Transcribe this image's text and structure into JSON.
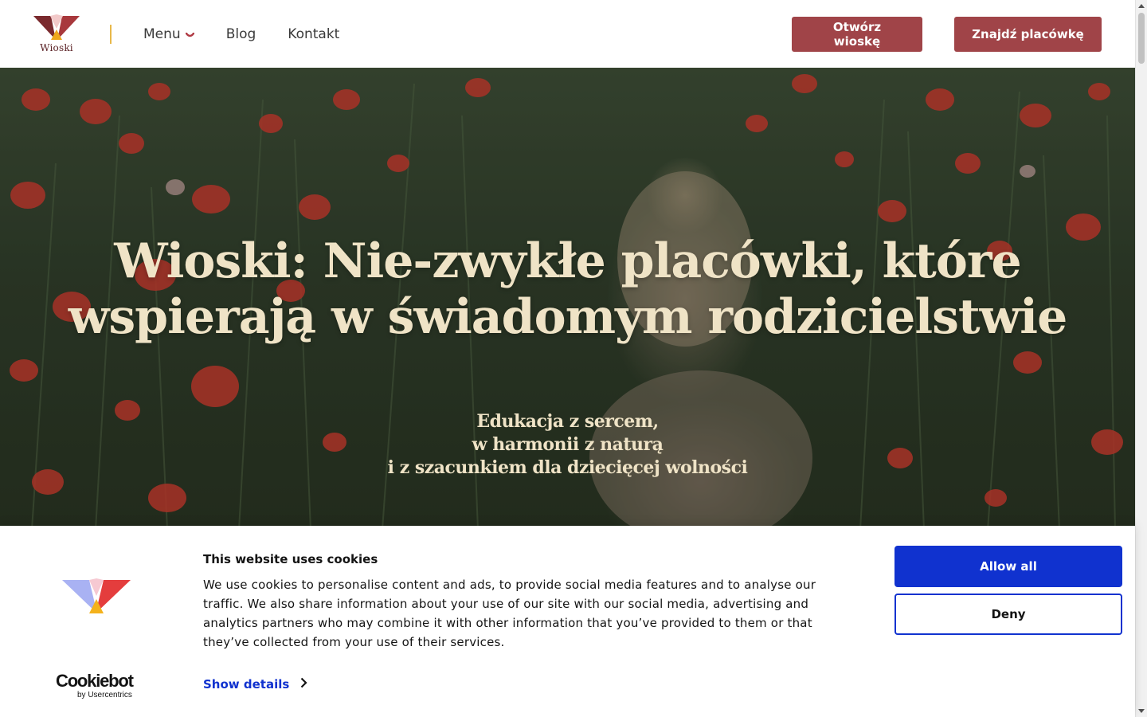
{
  "header": {
    "logo_text": "Wioski",
    "nav": [
      {
        "label": "Menu",
        "has_dropdown": true
      },
      {
        "label": "Blog"
      },
      {
        "label": "Kontakt"
      }
    ],
    "buttons": {
      "open_village": "Otwórz wioskę",
      "find_facility": "Znajdź placówkę"
    }
  },
  "hero": {
    "title": "Wioski: Nie-zwykłe placówki, które wspierają w świadomym rodzicielstwie",
    "subtitle_lines": [
      "Edukacja z sercem,",
      "w harmonii z naturą",
      "i z szacunkiem dla dziecięcej wolności"
    ]
  },
  "cookie_banner": {
    "title": "This website uses cookies",
    "text": "We use cookies to personalise content and ads, to provide social media features and to analyse our traffic. We also share information about your use of our site with our social media, advertising and analytics partners who may combine it with other information that you’ve provided to them or that they’ve collected from your use of their services.",
    "show_details": "Show details",
    "allow_all": "Allow all",
    "deny": "Deny",
    "brand_name": "Cookiebot",
    "brand_by": "by Usercentrics"
  },
  "colors": {
    "brand": "#a04448",
    "hero_text": "#efe3c6",
    "cookie_primary": "#1032cf",
    "divider": "#e8b84a"
  },
  "icons": {
    "menu_dropdown": "chevron-down-icon",
    "show_details": "chevron-right-icon"
  }
}
